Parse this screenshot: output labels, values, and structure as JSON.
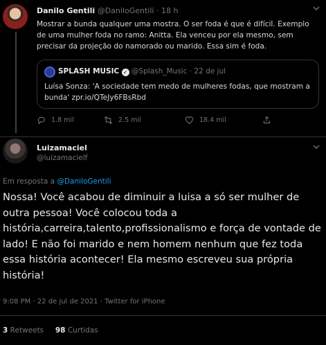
{
  "parent_tweet": {
    "author_name": "Danilo Gentili",
    "handle": "@DaniloGentili",
    "time": "18 h",
    "text": "Mostrar a bunda qualquer uma mostra. O ser foda é que é difícil. Exemplo de uma mulher foda no ramo: Anitta. Ela venceu por ela mesmo, sem precisar da projeção do namorado ou marido. Essa sim é foda.",
    "quoted": {
      "author_name": "SPLASH MUSIC",
      "handle": "@Splash_Music",
      "time": "22 de jul",
      "text": "Luísa Sonza: 'A sociedade tem medo de mulheres fodas, que mostram a bunda' zpr.io/QTeJy6FBsRbd"
    },
    "actions": {
      "replies": "1.8 mil",
      "retweets": "2.5 mil",
      "likes": "18.4 mil"
    }
  },
  "main_tweet": {
    "author_name": "Luizamaciel",
    "handle": "@luizamacielf",
    "reply_prefix": "Em resposta a ",
    "reply_to": "@DaniloGentili",
    "text": "Nossa! Você acabou de diminuir a luisa a só ser mulher de outra pessoa! Você colocou toda a história,carreira,talento,profissionalismo e força de vontade de lado! E não foi marido e nem homem nenhum que fez toda essa história acontecer! Ela mesmo escreveu sua própria história!",
    "meta": "9:08 PM · 22 de jul de 2021 · Twitter for iPhone",
    "retweets_count": "3",
    "retweets_label": "Retweets",
    "likes_count": "98",
    "likes_label": "Curtidas"
  },
  "icons": {
    "caret": "chevron-down-icon",
    "reply": "reply-icon",
    "retweet": "retweet-icon",
    "like": "heart-icon",
    "share": "share-icon",
    "verified": "verified-badge-icon"
  },
  "colors": {
    "background": "#000000",
    "link": "#1d9bf0",
    "muted": "#6e767d",
    "text": "#e7e9ea",
    "border": "#2f3336"
  }
}
